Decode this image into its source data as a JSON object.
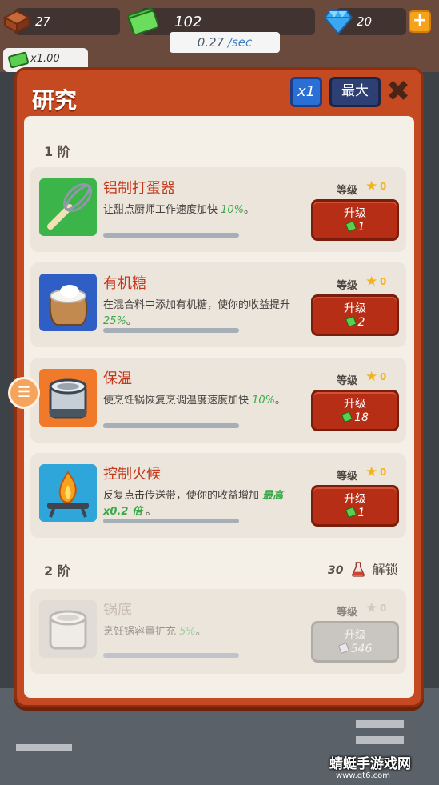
{
  "hud": {
    "bricks": "27",
    "cash": "102",
    "gems": "20",
    "rate_value": "0.27",
    "rate_unit": "/sec",
    "multiplier": "x1.00"
  },
  "panel": {
    "title": "研究",
    "x1_label": "x1",
    "max_label": "最大",
    "close_label": "✖"
  },
  "tiers": [
    {
      "label": "1 阶",
      "items": [
        {
          "name": "铝制打蛋器",
          "desc_before": "让甜点厨师工作速度加快 ",
          "desc_highlight": "10%",
          "desc_after": "。",
          "level_label": "等级",
          "level": "0",
          "upgrade_label": "升级",
          "cost": "1",
          "icon": "whisk-icon"
        },
        {
          "name": "有机糖",
          "desc_before": "在混合料中添加有机糖，使你的收益提升 ",
          "desc_highlight": "25%",
          "desc_after": "。",
          "level_label": "等级",
          "level": "0",
          "upgrade_label": "升级",
          "cost": "2",
          "icon": "sugar-sack-icon"
        },
        {
          "name": "保温",
          "desc_before": "使烹饪锅恢复烹调温度速度加快 ",
          "desc_highlight": "10%",
          "desc_after": "。",
          "level_label": "等级",
          "level": "0",
          "upgrade_label": "升级",
          "cost": "18",
          "icon": "pot-icon"
        },
        {
          "name": "控制火候",
          "desc_before": "反复点击传送带，使你的收益增加 ",
          "desc_highlight": "最高 x0.2 倍",
          "desc_after": " 。",
          "level_label": "等级",
          "level": "0",
          "upgrade_label": "升级",
          "cost": "1",
          "icon": "burner-flame-icon"
        }
      ]
    },
    {
      "label": "2 阶",
      "unlock_cost": "30",
      "unlock_label": "解锁",
      "items": [
        {
          "name": "锅底",
          "desc_before": "烹饪锅容量扩充 ",
          "desc_highlight": "5%",
          "desc_after": "。",
          "level_label": "等级",
          "level": "0",
          "upgrade_label": "升级",
          "cost": "546",
          "icon": "pot-icon"
        }
      ]
    }
  ],
  "watermark": {
    "text": "蜻蜓手游戏网",
    "url": "www.qt6.com"
  },
  "colors": {
    "panel": "#c54a22",
    "upgrade_button": "#b62e16",
    "highlight": "#3aa948",
    "title_red": "#c4371a"
  }
}
